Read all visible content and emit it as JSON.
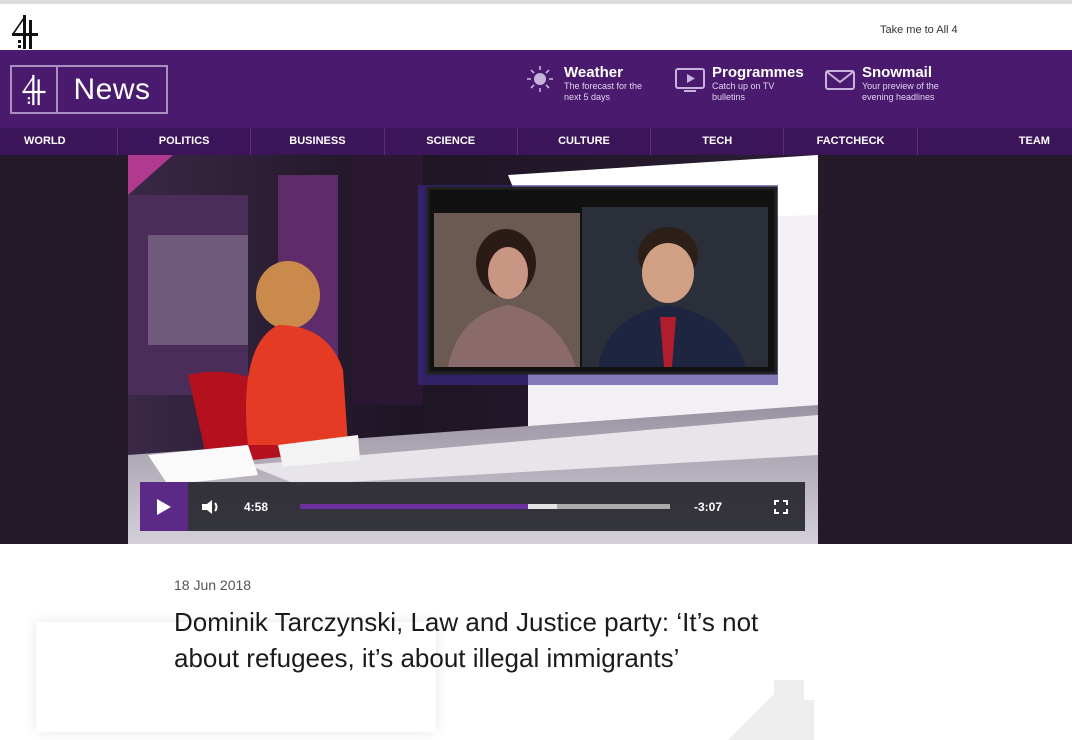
{
  "topbar": {
    "link": "Take me to All 4"
  },
  "masthead": {
    "brand": "News",
    "promos": [
      {
        "icon": "sun-icon",
        "title": "Weather",
        "sub": "The forecast for the next 5 days"
      },
      {
        "icon": "tv-play-icon",
        "title": "Programmes",
        "sub": "Catch up on TV bulletins"
      },
      {
        "icon": "envelope-icon",
        "title": "Snowmail",
        "sub": "Your preview of the evening headlines"
      }
    ]
  },
  "nav": [
    "WORLD",
    "POLITICS",
    "BUSINESS",
    "SCIENCE",
    "CULTURE",
    "TECH",
    "FACTCHECK",
    "TEAM"
  ],
  "player": {
    "elapsed": "4:58",
    "remaining": "-3:07",
    "progress_played": 0.617,
    "progress_buffered": 0.695
  },
  "article": {
    "date": "18 Jun 2018",
    "headline": "Dominik Tarczynski, Law and Justice party: ‘It’s not about refugees, it’s about illegal immigrants’"
  },
  "colors": {
    "brand_purple": "#4a1a6e",
    "nav_purple": "#3b1459",
    "accent": "#5b2a86"
  }
}
